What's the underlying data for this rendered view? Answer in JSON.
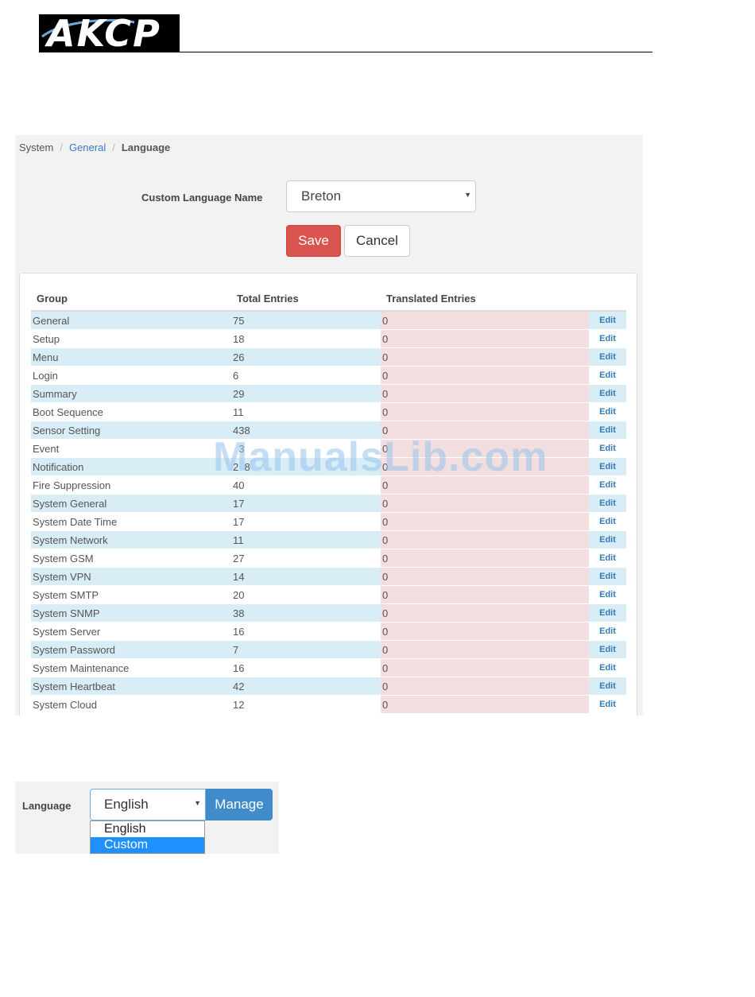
{
  "logo": {
    "text": "AKCP"
  },
  "breadcrumb": {
    "items": [
      "System",
      "General",
      "Language"
    ]
  },
  "form": {
    "label": "Custom Language Name",
    "selected": "Breton",
    "save_label": "Save",
    "cancel_label": "Cancel"
  },
  "table": {
    "headers": [
      "Group",
      "Total Entries",
      "Translated Entries"
    ],
    "edit_label": "Edit",
    "rows": [
      {
        "group": "General",
        "total": "75",
        "translated": "0"
      },
      {
        "group": "Setup",
        "total": "18",
        "translated": "0"
      },
      {
        "group": "Menu",
        "total": "26",
        "translated": "0"
      },
      {
        "group": "Login",
        "total": "6",
        "translated": "0"
      },
      {
        "group": "Summary",
        "total": "29",
        "translated": "0"
      },
      {
        "group": "Boot Sequence",
        "total": "11",
        "translated": "0"
      },
      {
        "group": "Sensor Setting",
        "total": "438",
        "translated": "0"
      },
      {
        "group": "Event",
        "total": "  3",
        "translated": "0"
      },
      {
        "group": "Notification",
        "total": "2  8",
        "translated": "0"
      },
      {
        "group": "Fire Suppression",
        "total": "40",
        "translated": "0"
      },
      {
        "group": "System General",
        "total": "17",
        "translated": "0"
      },
      {
        "group": "System Date Time",
        "total": "17",
        "translated": "0"
      },
      {
        "group": "System Network",
        "total": "11",
        "translated": "0"
      },
      {
        "group": "System GSM",
        "total": "27",
        "translated": "0"
      },
      {
        "group": "System VPN",
        "total": "14",
        "translated": "0"
      },
      {
        "group": "System SMTP",
        "total": "20",
        "translated": "0"
      },
      {
        "group": "System SNMP",
        "total": "38",
        "translated": "0"
      },
      {
        "group": "System Server",
        "total": "16",
        "translated": "0"
      },
      {
        "group": "System Password",
        "total": "7",
        "translated": "0"
      },
      {
        "group": "System Maintenance",
        "total": "16",
        "translated": "0"
      },
      {
        "group": "System Heartbeat",
        "total": "42",
        "translated": "0"
      },
      {
        "group": "System Cloud",
        "total": "12",
        "translated": "0"
      }
    ]
  },
  "watermark": "ManualsLib.com",
  "language_selector": {
    "label": "Language",
    "selected": "English",
    "manage_label": "Manage",
    "options": [
      "English",
      "Custom"
    ],
    "highlighted_option": "Custom"
  },
  "colors": {
    "save_button": "#d9534f",
    "manage_button": "#428bca",
    "row_stripe": "#d9edf7",
    "translated_cell": "#f2dede",
    "link": "#337ab7"
  }
}
